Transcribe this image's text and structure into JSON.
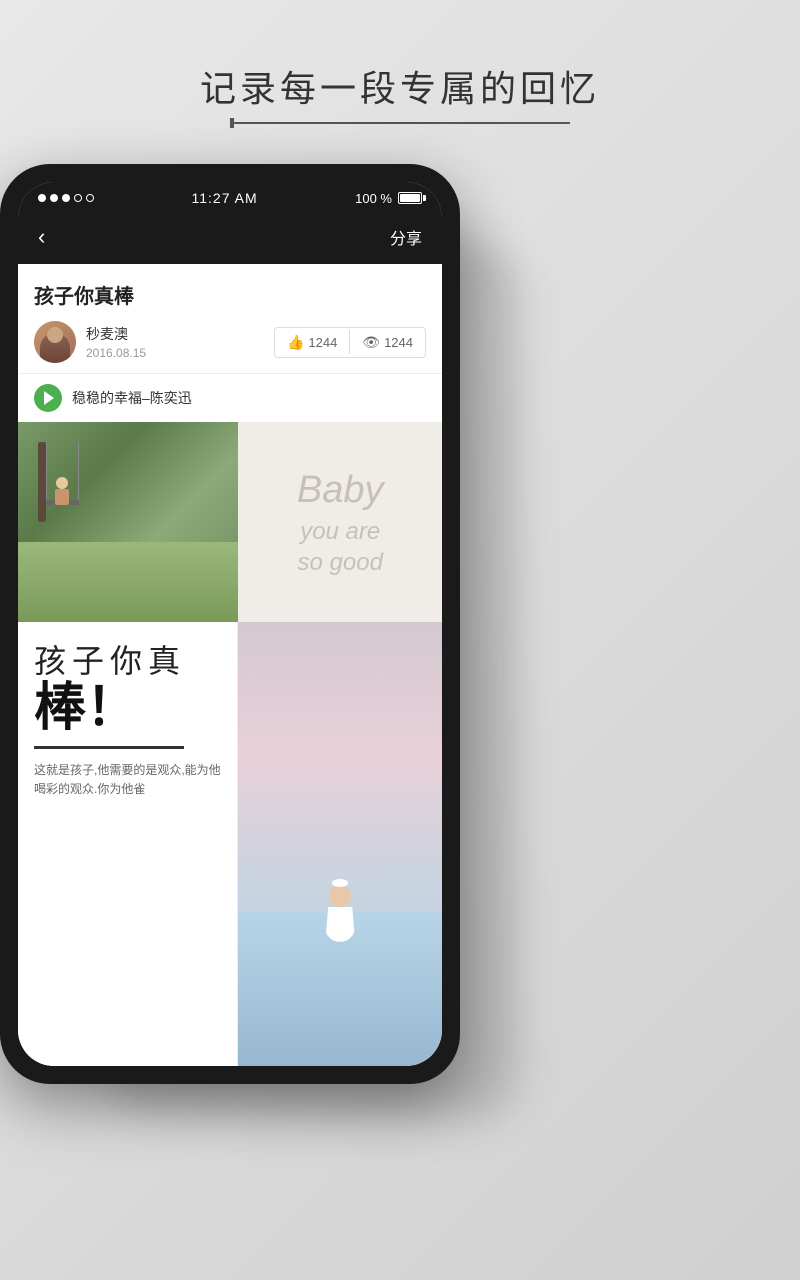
{
  "page": {
    "bg_title": "记录每一段专属的回忆"
  },
  "status_bar": {
    "dots_filled": 3,
    "dots_empty": 2,
    "time": "11:27 AM",
    "battery_percent": "100 %"
  },
  "nav": {
    "back_icon": "‹",
    "share_label": "分享"
  },
  "post": {
    "title": "孩子你真棒",
    "author_name": "秒麦澳",
    "author_date": "2016.08.15",
    "like_count": "1244",
    "view_count": "1244",
    "music_title": "稳稳的幸福–陈奕迅"
  },
  "image_right_text": {
    "line1": "Baby",
    "line2": "you are",
    "line3": "so good"
  },
  "bottom_text": {
    "line1": "孩子你真",
    "line2": "棒！",
    "caption": "这就是孩子,他需要的是观众,能为他喝彩的观众.你为他雀"
  }
}
